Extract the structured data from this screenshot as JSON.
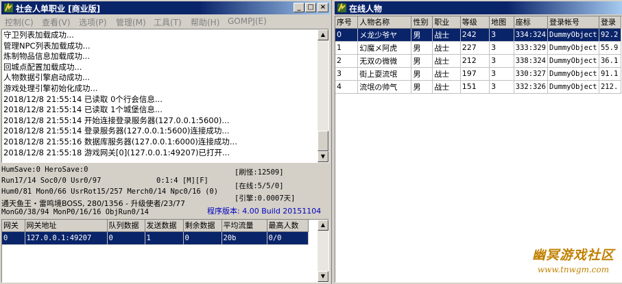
{
  "left_window": {
    "title": "社会人单职业 [商业版]",
    "controls": {
      "minimize": "_",
      "maximize": "□",
      "close": "×"
    },
    "menu": [
      "控制(C)",
      "查看(V)",
      "选项(P)",
      "管理(M)",
      "工具(T)",
      "帮助(H)",
      "GOMPJ(E)"
    ],
    "log_lines": [
      "守卫列表加载成功...",
      "管理NPC列表加载成功...",
      "炼制物品信息加载成功...",
      "回城点配置加载成功...",
      "人物数据引擎启动成功...",
      "游戏处理引擎初始化成功...",
      "2018/12/8 21:55:14 已读取 0个行会信息...",
      "2018/12/8 21:55:14 已读取 1个城堡信息...",
      "2018/12/8 21:55:14 开始连接登录服务器(127.0.0.1:5600)...",
      "2018/12/8 21:55:14 登录服务器(127.0.0.1:5600)连接成功...",
      "2018/12/8 21:55:16 数据库服务器(127.0.0.1:6000)连接成功...",
      "2018/12/8 21:55:18 游戏网关[0](127.0.0.1:49207)已打开..."
    ],
    "status": {
      "line1": "HumSave:0 HeroSave:0",
      "line2_left": "Run17/14 Soc0/0 Usr0/97",
      "line2_right": "0:1:4 [M][F]",
      "line3": "Hum0/81 Mon0/66 UsrRot15/257 Merch0/14 Npc0/16 (0)",
      "line4": "通天鱼王・雷鸣境BOSS, 280/1356 - 升级使者/23/77",
      "line5": "MonG0/38/94 MonP0/16/16 ObjRun0/14",
      "refresh": "[刷怪:12509]",
      "online": "[在线:5/5/0]",
      "engine": "[引擎:0.0007天]",
      "version": "程序版本: 4.00 Build 20151104"
    },
    "gateway_table": {
      "headers": [
        "网关",
        "网关地址",
        "队列数据",
        "发送数据",
        "剩余数据",
        "平均流量",
        "最高人数"
      ],
      "rows": [
        [
          "0",
          "127.0.0.1:49207",
          "0",
          "1",
          "0",
          "20b",
          "0/0"
        ]
      ]
    }
  },
  "right_window": {
    "title": "在线人物",
    "player_table": {
      "headers": [
        "序号",
        "人物名称",
        "性别",
        "职业",
        "等级",
        "地图",
        "座标",
        "登录帐号",
        "登录"
      ],
      "rows": [
        [
          "0",
          "メ龙少爷ヤ",
          "男",
          "战士",
          "242",
          "3",
          "334:324",
          "DummyObject",
          "92.2"
        ],
        [
          "1",
          "幻魔メ阿虎",
          "男",
          "战士",
          "227",
          "3",
          "333:329",
          "DummyObject",
          "55.9"
        ],
        [
          "2",
          "无双の微微",
          "男",
          "战士",
          "212",
          "3",
          "338:324",
          "DummyObject",
          "36.1"
        ],
        [
          "3",
          "街上耍流氓",
          "男",
          "战士",
          "197",
          "3",
          "330:327",
          "DummyObject",
          "91.1"
        ],
        [
          "4",
          "流氓の帅气",
          "男",
          "战士",
          "151",
          "3",
          "332:326",
          "DummyObject",
          "212."
        ]
      ]
    }
  },
  "watermark": {
    "name": "幽冥游戏社区",
    "url": "www.tnwgm.com"
  },
  "colors": {
    "titlebar": "#0a246a",
    "selection": "#0a246a",
    "version_text": "#0000c0",
    "watermark": "#c08000"
  }
}
